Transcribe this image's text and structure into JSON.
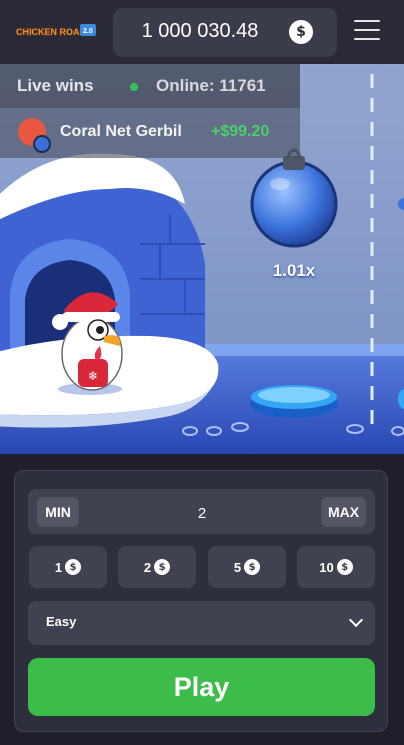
{
  "header": {
    "logo_text": "CHICKEN ROAD",
    "logo_badge": "2.0",
    "balance": "1 000 030.48",
    "currency_symbol": "$"
  },
  "live": {
    "live_label": "Live wins",
    "online_label": "Online: 11761",
    "latest_win": {
      "player": "Coral Net Gerbil",
      "amount": "+$99.20"
    }
  },
  "game": {
    "next_multiplier": "1.01x"
  },
  "controls": {
    "min_label": "MIN",
    "max_label": "MAX",
    "bet_value": "2",
    "quick_bets": [
      "1",
      "2",
      "5",
      "10"
    ],
    "difficulty": "Easy",
    "play_label": "Play"
  },
  "colors": {
    "accent_green": "#3cbd4a",
    "win_green": "#49d16a",
    "online_dot": "#35c25a"
  }
}
